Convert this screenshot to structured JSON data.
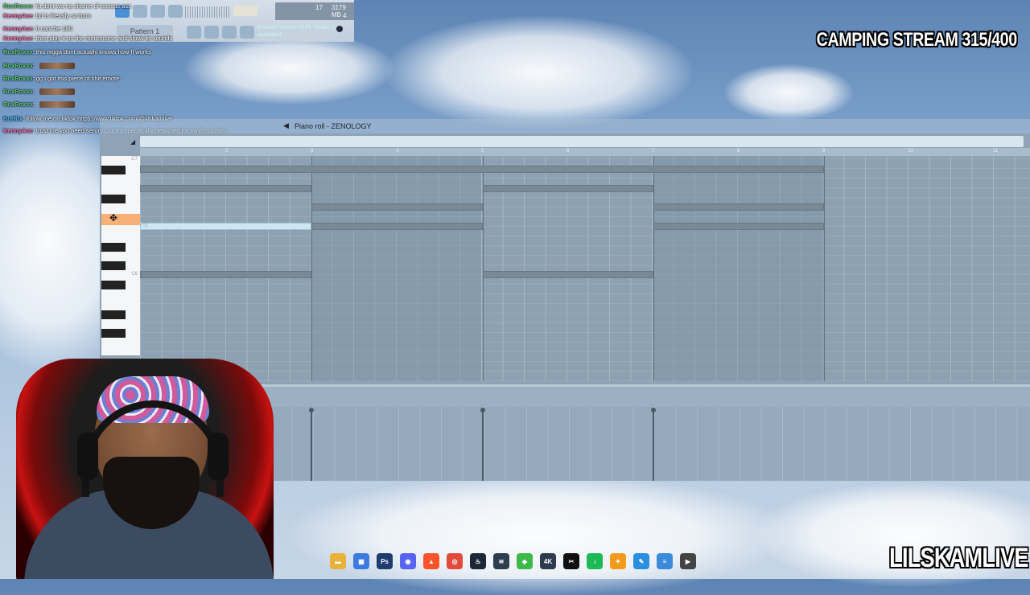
{
  "stream": {
    "title": "CAMPING STREAM 315/400",
    "channel": "LILSKAMLIVE"
  },
  "fl_toolbar": {
    "pattern_label": "Pattern 1",
    "cpu_value": "17",
    "memory_value": "3179 MB",
    "voices": "4",
    "update_notice": "A newer version of FL Studio is available!"
  },
  "chat": [
    {
      "user": "RoxRoxxx",
      "msg": "fu dont wa na shame of ooosuc ass",
      "color": "#5fd17a"
    },
    {
      "user": "KennyAce",
      "msg": "bri is literally so bom",
      "color": "#ff6fb0"
    },
    {
      "user": "KennyAce",
      "msg": "it cant be 180",
      "color": "#ff6fb0"
    },
    {
      "user": "KennyAce",
      "msg": "then play it on the metronome and show its sounds",
      "color": "#ff6fb0"
    },
    {
      "user": "RoxRoxxx",
      "msg": "this nigga dont actually knows how fl works",
      "color": "#5fd17a"
    },
    {
      "user": "RoxRoxxx",
      "msg": "",
      "color": "#5fd17a",
      "emote": true
    },
    {
      "user": "RoxRoxxx",
      "msg": "gg i got this piece of shit emote",
      "color": "#5fd17a"
    },
    {
      "user": "RoxRoxxx",
      "msg": "",
      "color": "#5fd17a",
      "emote": true
    },
    {
      "user": "RoxRoxxx",
      "msg": "",
      "color": "#5fd17a",
      "emote": true
    },
    {
      "user": "BotRix",
      "msg": "follow me on tiktok https://www.tiktok.com/@lilskamlive",
      "color": "#57b8ff"
    },
    {
      "user": "KennyAce",
      "msg": "trust me you need serum cuz it's specifically designed for synth sounds",
      "color": "#ff6fb0"
    }
  ],
  "piano_roll": {
    "title": "Piano roll - ZENOLOGY",
    "bar_numbers": [
      "2",
      "3",
      "4",
      "5",
      "6",
      "7",
      "8",
      "9",
      "10",
      "11"
    ],
    "octave_labels": [
      "C7",
      "C6"
    ],
    "note_label": "C6"
  },
  "taskbar": {
    "icons": [
      "file-explorer",
      "store",
      "photoshop",
      "discord",
      "brave",
      "chrome",
      "steam",
      "wifi-app",
      "green-app",
      "4k-downloader",
      "capcut",
      "spotify",
      "fl-studio",
      "paint",
      "notepad",
      "media-player"
    ]
  }
}
